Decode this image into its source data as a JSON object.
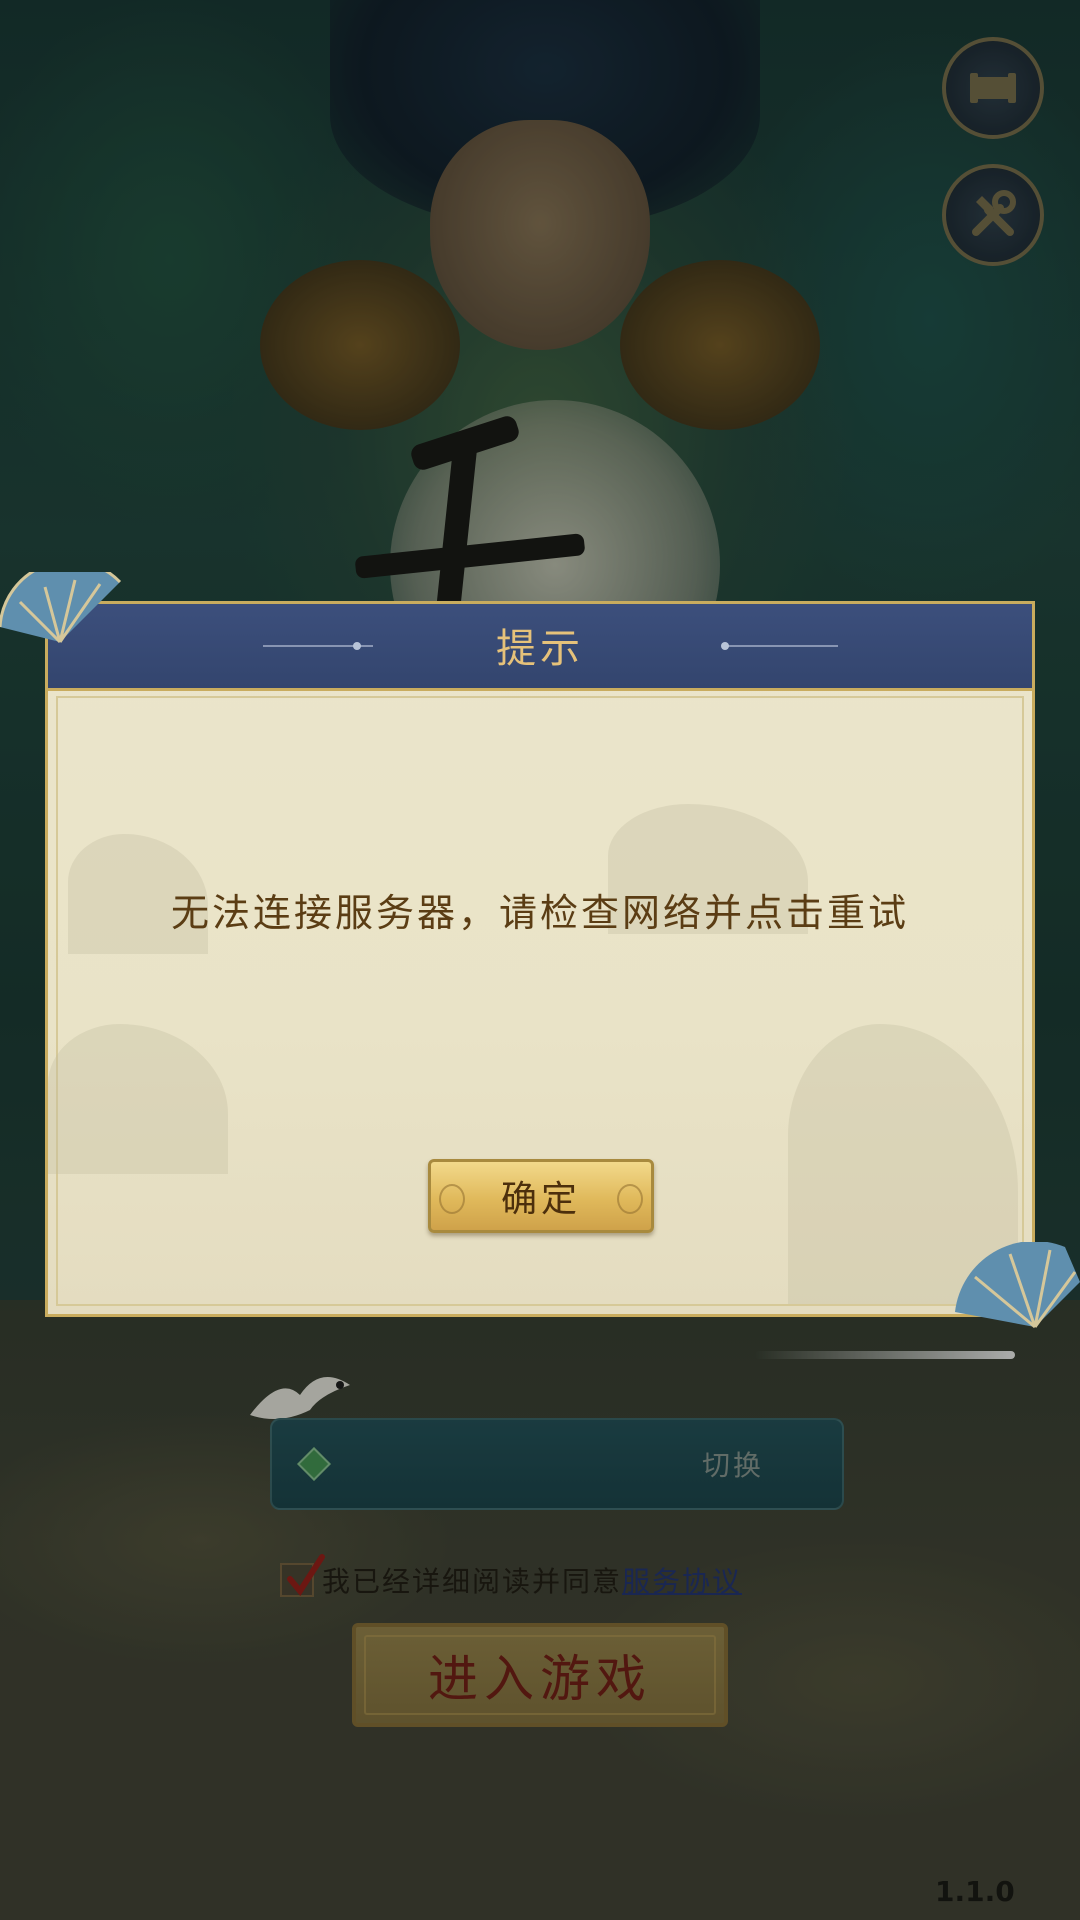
{
  "dialog": {
    "title": "提示",
    "message": "无法连接服务器，请检查网络并点击重试",
    "confirm_label": "确定"
  },
  "server": {
    "switch_label": "切换"
  },
  "agreement": {
    "checked": true,
    "text": "我已经详细阅读并同意",
    "link_label": "服务协议"
  },
  "enter_game_label": "进入游戏",
  "version": "1.1.0",
  "icons": {
    "top_button_1": "scroll-icon",
    "top_button_2": "tools-icon"
  },
  "colors": {
    "dialog_header": "#3c4f7c",
    "dialog_title": "#e6c27a",
    "dialog_body": "#ebe5cb",
    "dialog_border": "#c9ac5e",
    "message_text": "#5b3d14",
    "confirm_button": "#e0b95b",
    "link": "#1f2f6a",
    "enter_button_text": "#6a1a12"
  }
}
